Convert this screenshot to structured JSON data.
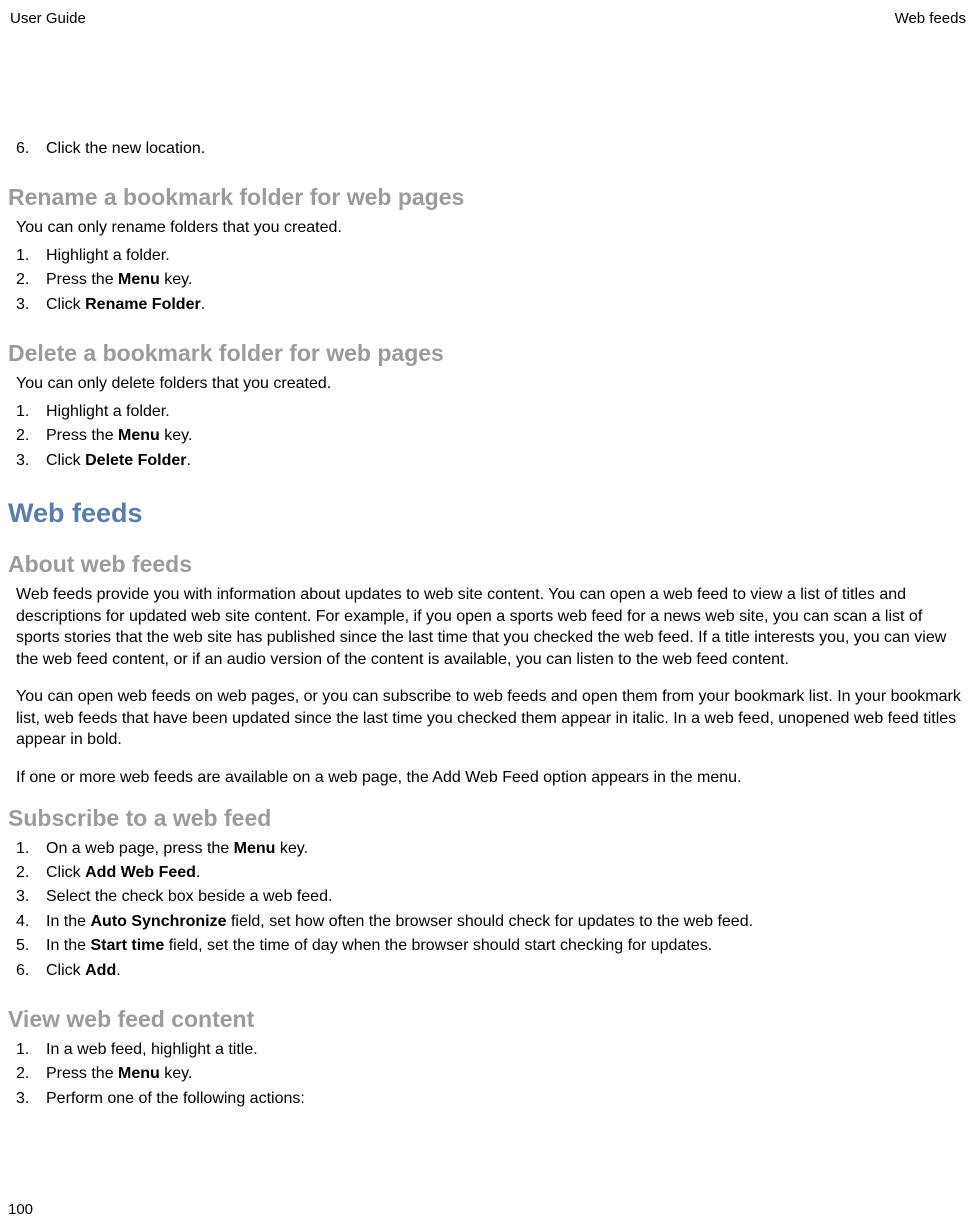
{
  "header": {
    "left": "User Guide",
    "right": "Web feeds"
  },
  "footer": {
    "page": "100"
  },
  "trailingStep": {
    "num": "6.",
    "text": "Click the new location."
  },
  "rename": {
    "heading": "Rename a bookmark folder for web pages",
    "note": "You can only rename folders that you created.",
    "steps": [
      {
        "num": "1.",
        "parts": [
          {
            "t": "Highlight a folder."
          }
        ]
      },
      {
        "num": "2.",
        "parts": [
          {
            "t": "Press the "
          },
          {
            "t": "Menu",
            "b": true
          },
          {
            "t": " key."
          }
        ]
      },
      {
        "num": "3.",
        "parts": [
          {
            "t": "Click "
          },
          {
            "t": "Rename Folder",
            "b": true
          },
          {
            "t": "."
          }
        ]
      }
    ]
  },
  "delete": {
    "heading": "Delete a bookmark folder for web pages",
    "note": "You can only delete folders that you created.",
    "steps": [
      {
        "num": "1.",
        "parts": [
          {
            "t": "Highlight a folder."
          }
        ]
      },
      {
        "num": "2.",
        "parts": [
          {
            "t": "Press the "
          },
          {
            "t": "Menu",
            "b": true
          },
          {
            "t": " key."
          }
        ]
      },
      {
        "num": "3.",
        "parts": [
          {
            "t": "Click "
          },
          {
            "t": "Delete Folder",
            "b": true
          },
          {
            "t": "."
          }
        ]
      }
    ]
  },
  "webfeeds": {
    "heading": "Web feeds"
  },
  "about": {
    "heading": "About web feeds",
    "p1": "Web feeds provide you with information about updates to web site content. You can open a web feed to view a list of titles and descriptions for updated web site content. For example, if you open a sports web feed for a news web site, you can scan a list of sports stories that the web site has published since the last time that you checked the web feed. If a title interests you, you can view the web feed content, or if an audio version of the content is available, you can listen to the web feed content.",
    "p2": "You can open web feeds on web pages, or you can subscribe to web feeds and open them from your bookmark list. In your bookmark list, web feeds that have been updated since the last time you checked them appear in italic. In a web feed, unopened web feed titles appear in bold.",
    "p3": "If one or more web feeds are available on a web page, the Add Web Feed option appears in the menu."
  },
  "subscribe": {
    "heading": "Subscribe to a web feed",
    "steps": [
      {
        "num": "1.",
        "parts": [
          {
            "t": "On a web page, press the "
          },
          {
            "t": "Menu",
            "b": true
          },
          {
            "t": " key."
          }
        ]
      },
      {
        "num": "2.",
        "parts": [
          {
            "t": "Click "
          },
          {
            "t": "Add Web Feed",
            "b": true
          },
          {
            "t": "."
          }
        ]
      },
      {
        "num": "3.",
        "parts": [
          {
            "t": "Select the check box beside a web feed."
          }
        ]
      },
      {
        "num": "4.",
        "parts": [
          {
            "t": "In the "
          },
          {
            "t": "Auto Synchronize",
            "b": true
          },
          {
            "t": " field, set how often the browser should check for updates to the web feed."
          }
        ]
      },
      {
        "num": "5.",
        "parts": [
          {
            "t": "In the "
          },
          {
            "t": "Start time",
            "b": true
          },
          {
            "t": " field, set the time of day when the browser should start checking for updates."
          }
        ]
      },
      {
        "num": "6.",
        "parts": [
          {
            "t": "Click "
          },
          {
            "t": "Add",
            "b": true
          },
          {
            "t": "."
          }
        ]
      }
    ]
  },
  "viewfeed": {
    "heading": "View web feed content",
    "steps": [
      {
        "num": "1.",
        "parts": [
          {
            "t": "In a web feed, highlight a title."
          }
        ]
      },
      {
        "num": "2.",
        "parts": [
          {
            "t": "Press the "
          },
          {
            "t": "Menu",
            "b": true
          },
          {
            "t": " key."
          }
        ]
      },
      {
        "num": "3.",
        "parts": [
          {
            "t": "Perform one of the following actions:"
          }
        ]
      }
    ]
  }
}
